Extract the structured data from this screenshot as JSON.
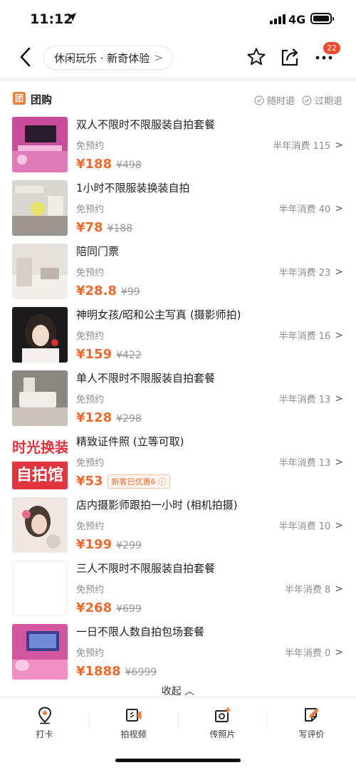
{
  "status_bar": {
    "time": "11:12",
    "network": "4G"
  },
  "nav": {
    "breadcrumb": "休闲玩乐 · 新奇体验",
    "more_badge": "22"
  },
  "section": {
    "title": "团购",
    "badge_glyph": "团",
    "tags": [
      "随时退",
      "过期退"
    ]
  },
  "deals": [
    {
      "name": "双人不限时不限服装自拍套餐",
      "booking": "免预约",
      "sold": "半年消费 115",
      "price": "¥188",
      "original": "¥498",
      "promo": ""
    },
    {
      "name": "1小时不限服装换装自拍",
      "booking": "免预约",
      "sold": "半年消费 40",
      "price": "¥78",
      "original": "¥188",
      "promo": ""
    },
    {
      "name": "陪同门票",
      "booking": "免预约",
      "sold": "半年消费 23",
      "price": "¥28.8",
      "original": "¥99",
      "promo": ""
    },
    {
      "name": "神明女孩/昭和公主写真 (摄影师拍)",
      "booking": "免预约",
      "sold": "半年消费 16",
      "price": "¥159",
      "original": "¥422",
      "promo": ""
    },
    {
      "name": "单人不限时不限服装自拍套餐",
      "booking": "免预约",
      "sold": "半年消费 13",
      "price": "¥128",
      "original": "¥298",
      "promo": ""
    },
    {
      "name": "精致证件照 (立等可取)",
      "booking": "免预约",
      "sold": "半年消费 13",
      "price": "¥53",
      "original": "",
      "promo": "新客已优惠6"
    },
    {
      "name": "店内摄影师跟拍一小时 (相机拍摄)",
      "booking": "免预约",
      "sold": "半年消费 10",
      "price": "¥199",
      "original": "¥299",
      "promo": ""
    },
    {
      "name": "三人不限时不限服装自拍套餐",
      "booking": "免预约",
      "sold": "半年消费 8",
      "price": "¥268",
      "original": "¥699",
      "promo": ""
    },
    {
      "name": "一日不限人数自拍包场套餐",
      "booking": "免预约",
      "sold": "半年消费 0",
      "price": "¥1888",
      "original": "¥6999",
      "promo": ""
    }
  ],
  "thumb_text": [
    "时光换装",
    "自拍馆"
  ],
  "collapse_label": "收起 ︿",
  "tabbar": [
    "打卡",
    "拍视频",
    "传照片",
    "写评价"
  ],
  "icons": {
    "status": [
      "location-arrow-icon",
      "signal-icon",
      "battery-icon"
    ],
    "nav": [
      "back-icon",
      "star-icon",
      "share-icon",
      "more-icon"
    ],
    "tabbar": [
      "location-pin-icon",
      "video-camera-icon",
      "add-photo-icon",
      "write-review-icon"
    ]
  },
  "colors": {
    "accent": "#ee6a2c",
    "badge": "#ee4a2e",
    "section_badge": "#f07c3b"
  }
}
